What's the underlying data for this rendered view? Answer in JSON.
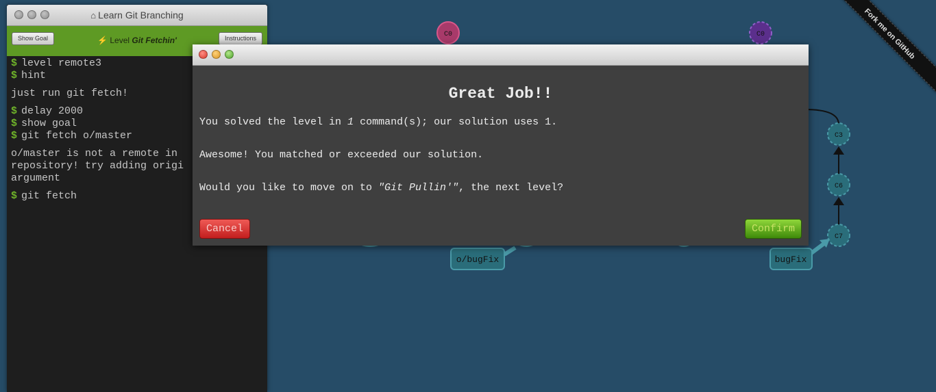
{
  "terminal": {
    "title": "Learn Git Branching",
    "home_icon": "home-icon",
    "show_goal_label": "Show Goal",
    "instructions_label": "Instructions",
    "level_prefix": "Level",
    "level_name": "Git Fetchin'",
    "prompt": "$",
    "lines": [
      {
        "type": "cmd",
        "text": "level remote3"
      },
      {
        "type": "cmd",
        "text": "hint"
      },
      {
        "type": "out",
        "text": "just run git fetch!"
      },
      {
        "type": "cmd",
        "text": "delay 2000"
      },
      {
        "type": "cmd",
        "text": "show goal"
      },
      {
        "type": "cmd",
        "text": "git fetch o/master"
      },
      {
        "type": "out",
        "text": "o/master is not a remote in\nrepository! try adding origi\nargument"
      },
      {
        "type": "cmd",
        "text": "git fetch"
      }
    ]
  },
  "modal": {
    "heading": "Great Job!!",
    "p1_before": "You solved the level in ",
    "p1_count": "1",
    "p1_after": " command(s); our solution uses 1.",
    "p2": "Awesome! You matched or exceeded our solution.",
    "p3_before": "Would you like to move on to ",
    "p3_level": "\"Git Pullin'\"",
    "p3_after": ", the next level?",
    "cancel_label": "Cancel",
    "confirm_label": "Confirm"
  },
  "ribbon": {
    "label": "Fork me on GitHub"
  },
  "graph": {
    "commits": [
      "C0",
      "C0",
      "C3",
      "C6",
      "C7"
    ],
    "branches": [
      "o/bugFix",
      "bugFix"
    ]
  },
  "colors": {
    "background": "#264c67",
    "commit_pink": "#a83a6a",
    "commit_purple": "#5b2f8c",
    "commit_teal": "#2a6d7a",
    "level_bar": "#5e9a24"
  }
}
